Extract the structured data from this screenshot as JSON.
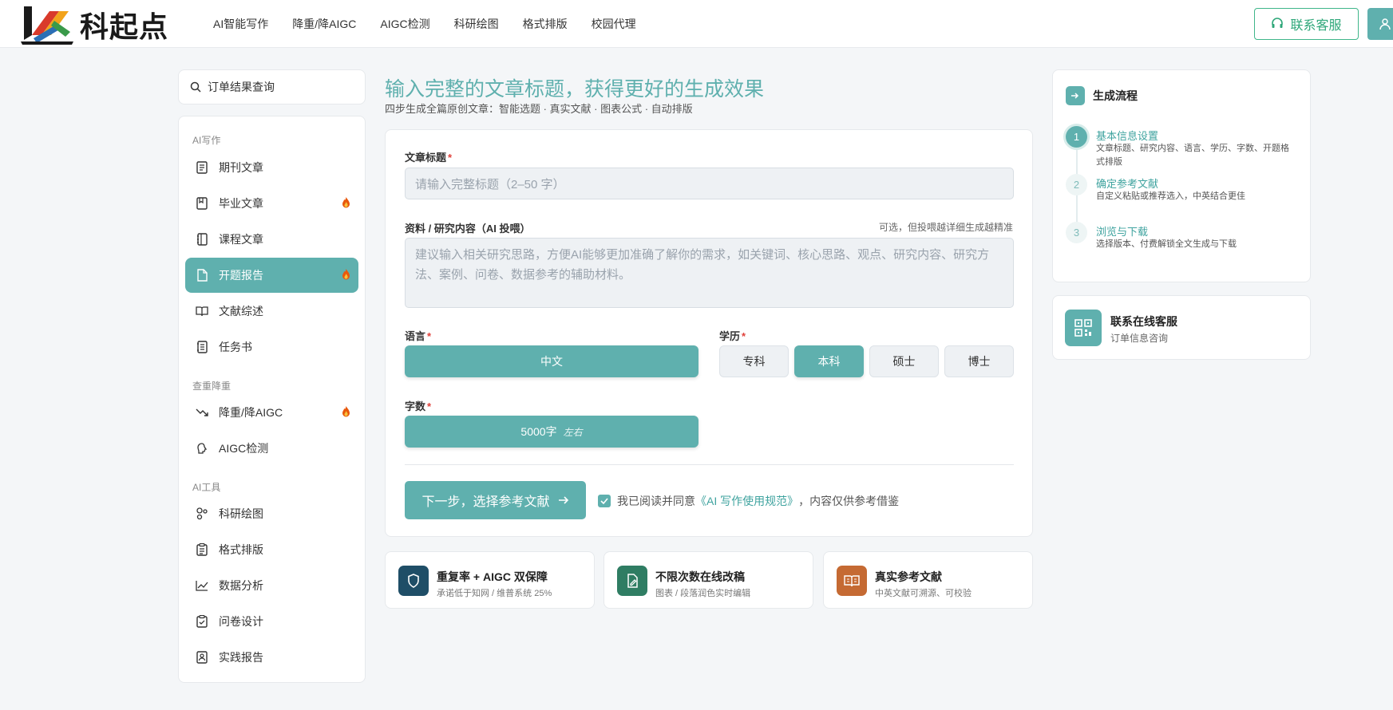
{
  "header": {
    "brand": "科起点",
    "nav": [
      "AI智能写作",
      "降重/降AIGC",
      "AIGC检测",
      "科研绘图",
      "格式排版",
      "校园代理"
    ],
    "contact_label": "联系客服"
  },
  "sidebar": {
    "search_label": "订单结果查询",
    "groups": [
      "AI写作",
      "查重降重",
      "AI工具"
    ],
    "items": [
      {
        "label": "期刊文章",
        "icon": "document-icon"
      },
      {
        "label": "毕业文章",
        "icon": "book-icon",
        "hot": true
      },
      {
        "label": "课程文章",
        "icon": "notebook-icon"
      },
      {
        "label": "开题报告",
        "icon": "file-icon",
        "hot": true,
        "active": true
      },
      {
        "label": "文献综述",
        "icon": "open-book-icon"
      },
      {
        "label": "任务书",
        "icon": "list-doc-icon"
      },
      {
        "label": "降重/降AIGC",
        "icon": "trend-down-icon",
        "hot": true
      },
      {
        "label": "AIGC检测",
        "icon": "brain-icon"
      },
      {
        "label": "科研绘图",
        "icon": "shapes-icon"
      },
      {
        "label": "格式排版",
        "icon": "clipboard-icon"
      },
      {
        "label": "数据分析",
        "icon": "line-chart-icon"
      },
      {
        "label": "问卷设计",
        "icon": "clipboard-check-icon"
      },
      {
        "label": "实践报告",
        "icon": "id-card-icon"
      }
    ]
  },
  "main": {
    "title": "输入完整的文章标题，获得更好的生成效果",
    "subtitle": "四步生成全篇原创文章：智能选题 · 真实文献 · 图表公式 · 自动排版",
    "form": {
      "title_label": "文章标题",
      "title_placeholder": "请输入完整标题（2–50 字）",
      "material_label": "资料 / 研究内容（AI 投喂）",
      "material_hint": "可选，但投喂越详细生成越精准",
      "material_placeholder": "建议输入相关研究思路，方便AI能够更加准确了解你的需求，如关键词、核心思路、观点、研究内容、研究方法、案例、问卷、数据参考的辅助材料。",
      "language_label": "语言",
      "language_value": "中文",
      "degree_label": "学历",
      "degrees": [
        "专科",
        "本科",
        "硕士",
        "博士"
      ],
      "degree_selected": "本科",
      "words_label": "字数",
      "words_value": "5000字",
      "words_suffix": "左右",
      "next_button": "下一步，选择参考文献",
      "agree_prefix": "我已阅读并同意",
      "agree_link": "《AI 写作使用规范》",
      "agree_suffix": "，内容仅供参考借鉴",
      "agree_checked": true
    },
    "features": [
      {
        "title": "重复率 + AIGC 双保障",
        "desc": "承诺低于知网 / 维普系统 25%",
        "icon": "shield-icon",
        "color": "#1f4e67"
      },
      {
        "title": "不限次数在线改稿",
        "desc": "图表 / 段落润色实时编辑",
        "icon": "edit-file-icon",
        "color": "#2f7d63"
      },
      {
        "title": "真实参考文献",
        "desc": "中英文献可溯源、可校验",
        "icon": "book-open-icon",
        "color": "#c56a33"
      }
    ]
  },
  "flow": {
    "title": "生成流程",
    "steps": [
      {
        "num": "1",
        "title": "基本信息设置",
        "desc": "文章标题、研究内容、语言、学历、字数、开题格式排版"
      },
      {
        "num": "2",
        "title": "确定参考文献",
        "desc": "自定义粘贴或推荐选入，中英结合更佳"
      },
      {
        "num": "3",
        "title": "浏览与下载",
        "desc": "选择版本、付费解锁全文生成与下载"
      }
    ]
  },
  "service": {
    "title": "联系在线客服",
    "desc": "订单信息咨询"
  },
  "colors": {
    "accent": "#5fb0ae",
    "hot": "#e8580c",
    "green": "#2ea779"
  }
}
